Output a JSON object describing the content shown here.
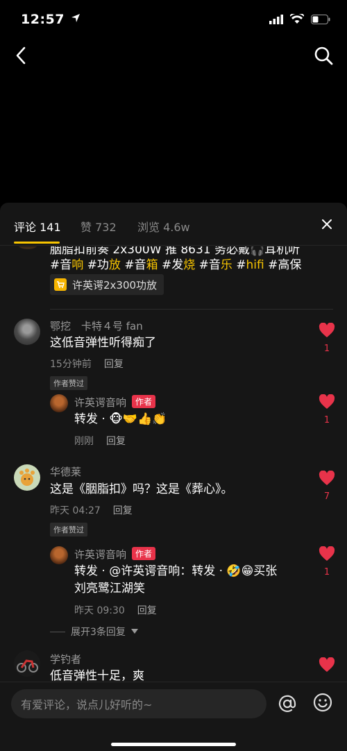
{
  "status": {
    "time": "12:57"
  },
  "tabs": [
    {
      "label": "评论 141"
    },
    {
      "label": "赞 732"
    },
    {
      "label": "浏览 4.6w"
    }
  ],
  "post": {
    "line1": "胭脂扣前奏 2x300W 推 8631 务必戴🎧耳机听",
    "hashtags": [
      {
        "hash": "#音",
        "acc": "响"
      },
      {
        "hash": "#功",
        "acc": "放"
      },
      {
        "hash": "#音",
        "acc": "箱"
      },
      {
        "hash": "#发",
        "acc": "烧"
      },
      {
        "hash": "#音",
        "acc": "乐"
      },
      {
        "hash": "#",
        "acc": "hifi"
      },
      {
        "hash": "#高保",
        "acc": ""
      }
    ],
    "product": "许英谔2x300功放"
  },
  "comments": [
    {
      "name": "鄂挖　卡特４号 fan",
      "text": "这低音弹性听得痴了",
      "time": "15分钟前",
      "reply": "回复",
      "badge": "作者赞过",
      "likes": "1",
      "reply_item": {
        "name": "许英谔音响",
        "tag": "作者",
        "text": "转发 · 🐵🤝👍👏",
        "time": "刚刚",
        "reply": "回复",
        "likes": "1"
      }
    },
    {
      "name": "华德莱",
      "text": "这是《胭脂扣》吗？这是《葬心》。",
      "time": "昨天 04:27",
      "reply": "回复",
      "badge": "作者赞过",
      "likes": "7",
      "reply_item": {
        "name": "许英谔音响",
        "tag": "作者",
        "text1": "转发 · @许英谔音响：转发 · 🤣😁买张",
        "text2": "刘亮鹭江湖笑",
        "time": "昨天 09:30",
        "reply": "回复",
        "likes": "1"
      },
      "expand": "展开3条回复"
    },
    {
      "name": "学钓者",
      "text": "低音弹性十足，爽"
    }
  ],
  "input": {
    "placeholder": "有爱评论，说点儿好听的~"
  },
  "colors": {
    "accent": "#f7c400",
    "like": "#e8334a",
    "sheet": "#161616"
  }
}
